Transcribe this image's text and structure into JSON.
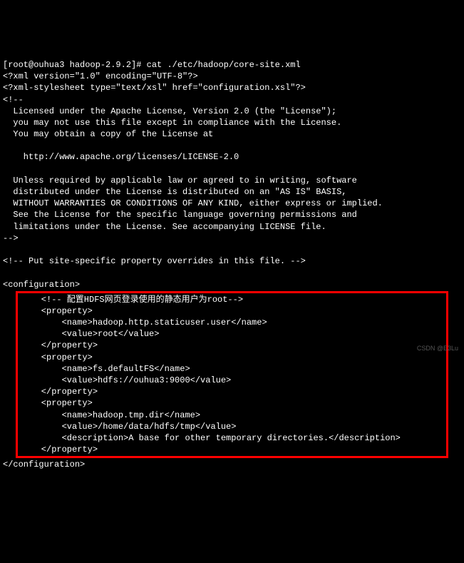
{
  "prompt": "[root@ouhua3 hadoop-2.9.2]# cat ./etc/hadoop/core-site.xml",
  "lines_top": [
    "<?xml version=\"1.0\" encoding=\"UTF-8\"?>",
    "<?xml-stylesheet type=\"text/xsl\" href=\"configuration.xsl\"?>",
    "<!--",
    "  Licensed under the Apache License, Version 2.0 (the \"License\");",
    "  you may not use this file except in compliance with the License.",
    "  You may obtain a copy of the License at",
    "",
    "    http://www.apache.org/licenses/LICENSE-2.0",
    "",
    "  Unless required by applicable law or agreed to in writing, software",
    "  distributed under the License is distributed on an \"AS IS\" BASIS,",
    "  WITHOUT WARRANTIES OR CONDITIONS OF ANY KIND, either express or implied.",
    "  See the License for the specific language governing permissions and",
    "  limitations under the License. See accompanying LICENSE file.",
    "-->",
    "",
    "<!-- Put site-specific property overrides in this file. -->",
    "",
    "<configuration>"
  ],
  "highlight_lines": [
    "    <!-- 配置HDFS网页登录使用的静态用户为root-->",
    "    <property>",
    "        <name>hadoop.http.staticuser.user</name>",
    "        <value>root</value>",
    "    </property>",
    "    <property>",
    "        <name>fs.defaultFS</name>",
    "        <value>hdfs://ouhua3:9000</value>",
    "    </property>",
    "    <property>",
    "        <name>hadoop.tmp.dir</name>",
    "        <value>/home/data/hdfs/tmp</value>",
    "        <description>A base for other temporary directories.</description>",
    "    </property>"
  ],
  "lines_bottom": [
    "</configuration>"
  ],
  "watermark": "CSDN @E3Lu"
}
